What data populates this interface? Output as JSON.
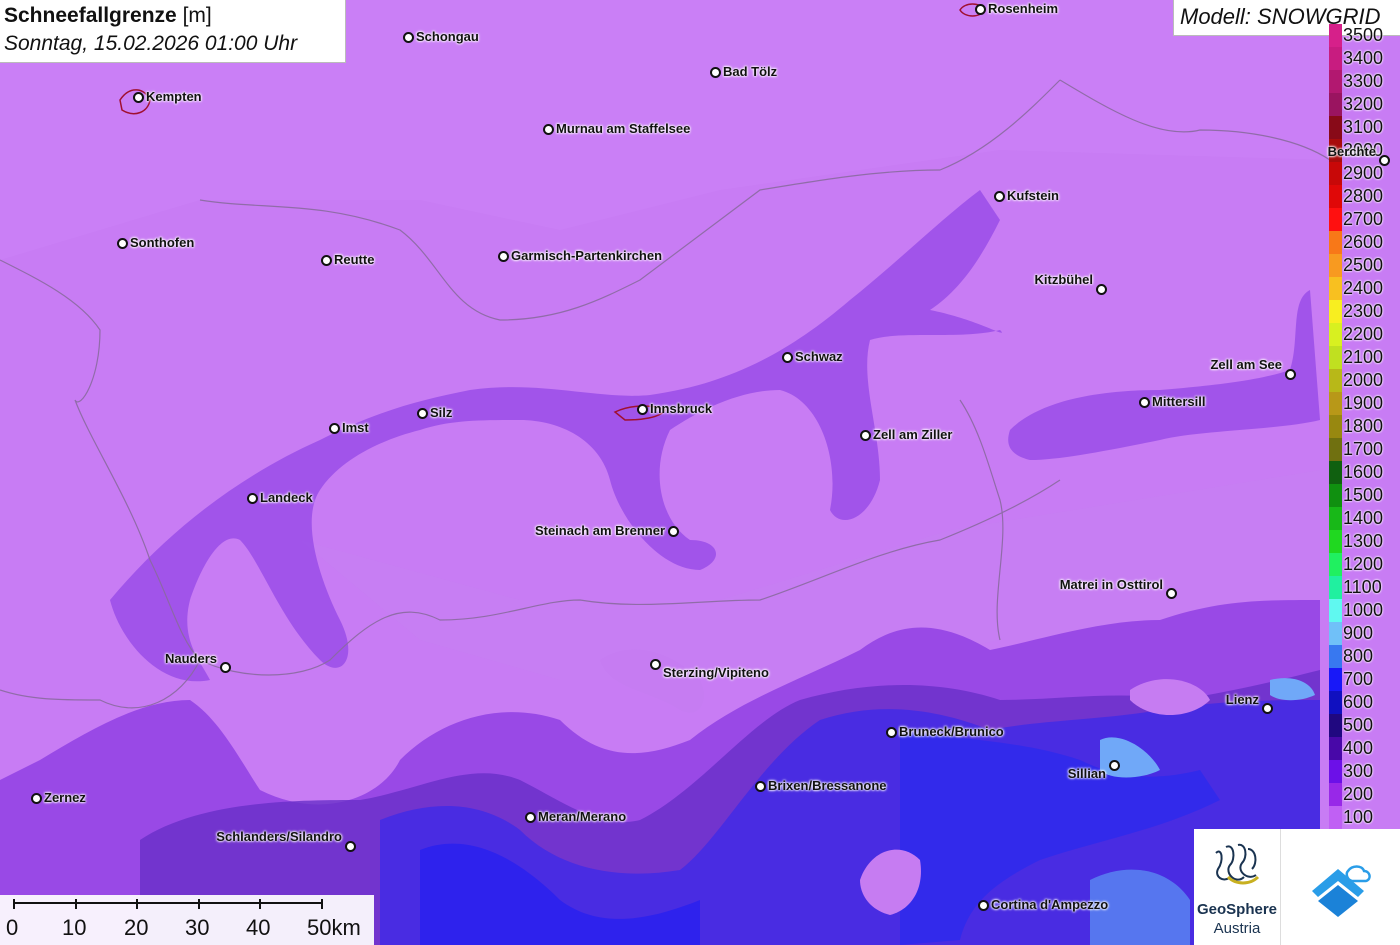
{
  "header": {
    "title_bold": "Schneefallgrenze",
    "title_unit": "[m]",
    "subtitle": "Sonntag, 15.02.2026 01:00 Uhr",
    "model_label": "Modell: SNOWGRID"
  },
  "legend": {
    "items": [
      {
        "label": "3500",
        "color": "#d6208a"
      },
      {
        "label": "3400",
        "color": "#c81c80"
      },
      {
        "label": "3300",
        "color": "#b21870"
      },
      {
        "label": "3200",
        "color": "#9a1460"
      },
      {
        "label": "3100",
        "color": "#880a18"
      },
      {
        "label": "3000",
        "color": "#a80c0c"
      },
      {
        "label": "2900",
        "color": "#c80808"
      },
      {
        "label": "2800",
        "color": "#e00808"
      },
      {
        "label": "2700",
        "color": "#ff1010"
      },
      {
        "label": "2600",
        "color": "#f87818"
      },
      {
        "label": "2500",
        "color": "#f89a20"
      },
      {
        "label": "2400",
        "color": "#f8c020"
      },
      {
        "label": "2300",
        "color": "#f8ee20"
      },
      {
        "label": "2200",
        "color": "#d8f020"
      },
      {
        "label": "2100",
        "color": "#c0e020"
      },
      {
        "label": "2000",
        "color": "#b8b818"
      },
      {
        "label": "1900",
        "color": "#b89818"
      },
      {
        "label": "1800",
        "color": "#988810"
      },
      {
        "label": "1700",
        "color": "#707010"
      },
      {
        "label": "1600",
        "color": "#106010"
      },
      {
        "label": "1500",
        "color": "#109010"
      },
      {
        "label": "1400",
        "color": "#18b818"
      },
      {
        "label": "1300",
        "color": "#20d820"
      },
      {
        "label": "1200",
        "color": "#20f060"
      },
      {
        "label": "1100",
        "color": "#20f0a0"
      },
      {
        "label": "1000",
        "color": "#60f8f0"
      },
      {
        "label": "900",
        "color": "#70c0f8"
      },
      {
        "label": "800",
        "color": "#3878f0"
      },
      {
        "label": "700",
        "color": "#1818f8"
      },
      {
        "label": "600",
        "color": "#1010c0"
      },
      {
        "label": "500",
        "color": "#200880"
      },
      {
        "label": "400",
        "color": "#4808a8"
      },
      {
        "label": "300",
        "color": "#6c10e8"
      },
      {
        "label": "200",
        "color": "#9828e8"
      },
      {
        "label": "100",
        "color": "#c060f4"
      }
    ]
  },
  "cities": [
    {
      "name": "Rosenheim"
    },
    {
      "name": "Schongau"
    },
    {
      "name": "Bad Tölz"
    },
    {
      "name": "Kempten"
    },
    {
      "name": "Murnau am Staffelsee"
    },
    {
      "name": "Berchte"
    },
    {
      "name": "Kufstein"
    },
    {
      "name": "Sonthofen"
    },
    {
      "name": "Reutte"
    },
    {
      "name": "Garmisch-Partenkirchen"
    },
    {
      "name": "Kitzbühel"
    },
    {
      "name": "Schwaz"
    },
    {
      "name": "Zell am See"
    },
    {
      "name": "Mittersill"
    },
    {
      "name": "Innsbruck"
    },
    {
      "name": "Silz"
    },
    {
      "name": "Imst"
    },
    {
      "name": "Zell am Ziller"
    },
    {
      "name": "Landeck"
    },
    {
      "name": "Steinach am Brenner"
    },
    {
      "name": "Matrei in Osttirol"
    },
    {
      "name": "Nauders"
    },
    {
      "name": "Sterzing/Vipiteno"
    },
    {
      "name": "Lienz"
    },
    {
      "name": "Bruneck/Brunico"
    },
    {
      "name": "Sillian"
    },
    {
      "name": "Brixen/Bressanone"
    },
    {
      "name": "Zernez"
    },
    {
      "name": "Meran/Merano"
    },
    {
      "name": "Schlanders/Silandro"
    },
    {
      "name": "Cortina d'Ampezzo"
    }
  ],
  "scale": {
    "ticks": [
      "0",
      "10",
      "20",
      "30",
      "40",
      "50km"
    ]
  },
  "logos": {
    "geosphere_line1": "GeoSphere",
    "geosphere_line2": "Austria"
  }
}
